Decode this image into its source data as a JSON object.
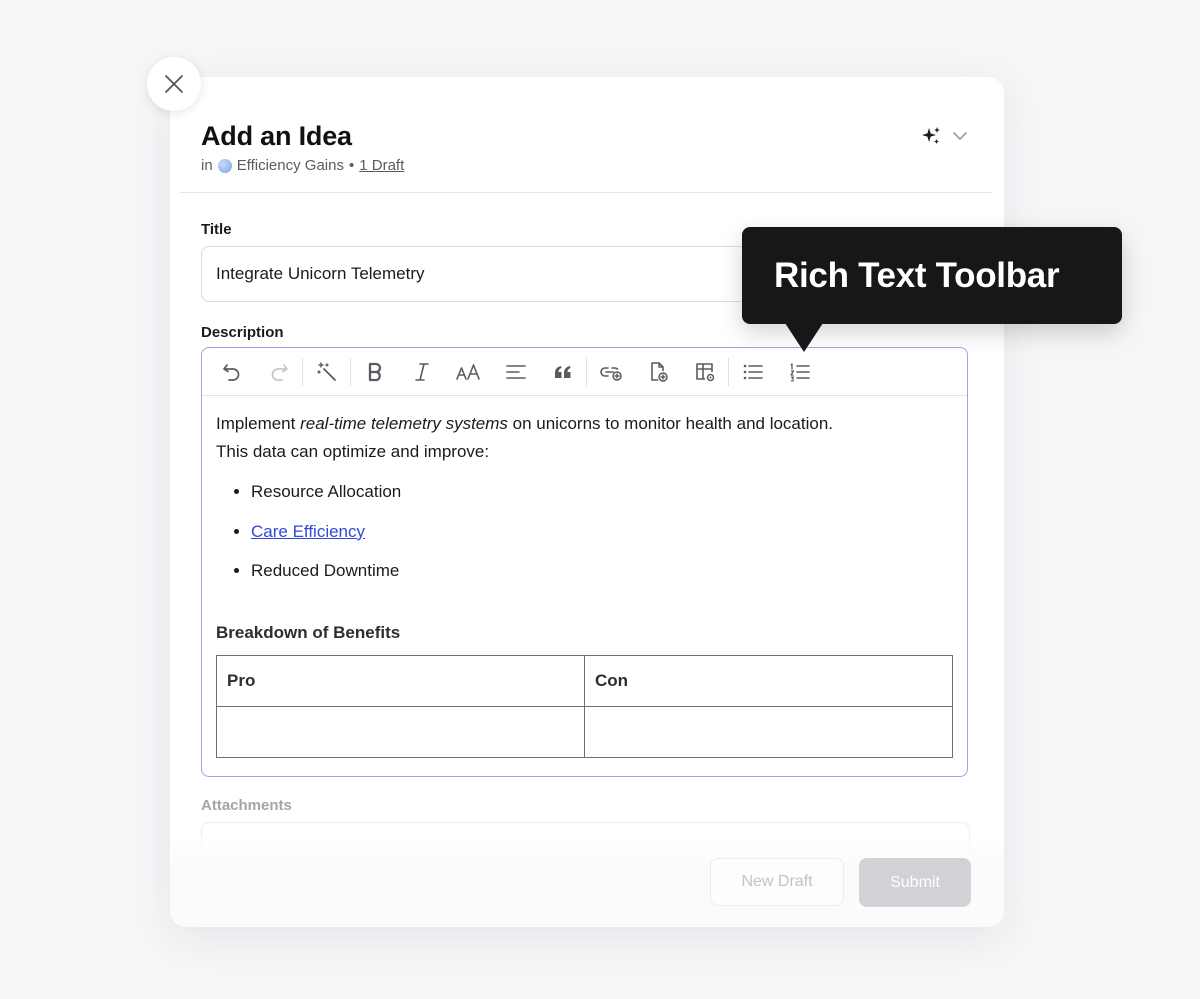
{
  "modal": {
    "title": "Add an Idea",
    "sub_prefix": "in",
    "space_name": "Efficiency Gains",
    "separator": "•",
    "draft_link": "1 Draft"
  },
  "fields": {
    "title_label": "Title",
    "title_value": "Integrate Unicorn Telemetry",
    "description_label": "Description",
    "attachments_label": "Attachments"
  },
  "toolbar": {
    "items": [
      "undo-icon",
      "redo-icon",
      "magic-wand-icon",
      "bold-icon",
      "italic-icon",
      "text-size-icon",
      "align-icon",
      "quote-icon",
      "insert-link-icon",
      "insert-file-icon",
      "insert-table-icon",
      "bulleted-list-icon",
      "numbered-list-icon"
    ]
  },
  "description": {
    "intro_before": "Implement ",
    "intro_italic": "real-time telemetry systems",
    "intro_after": " on unicorns to monitor health and location.",
    "intro_line2": "This data can optimize and improve:",
    "bullets": [
      "Resource Allocation",
      "Care Efficiency",
      "Reduced Downtime"
    ],
    "heading": "Breakdown of Benefits",
    "table_headers": [
      "Pro",
      "Con"
    ],
    "table_rows": [
      [
        "",
        ""
      ]
    ]
  },
  "buttons": {
    "new_draft": "New Draft",
    "submit": "Submit"
  },
  "tooltip": {
    "text": "Rich Text Toolbar"
  },
  "colors": {
    "accent_border": "#9ea3e8",
    "link": "#3248d8",
    "tooltip_bg": "#17171a"
  }
}
